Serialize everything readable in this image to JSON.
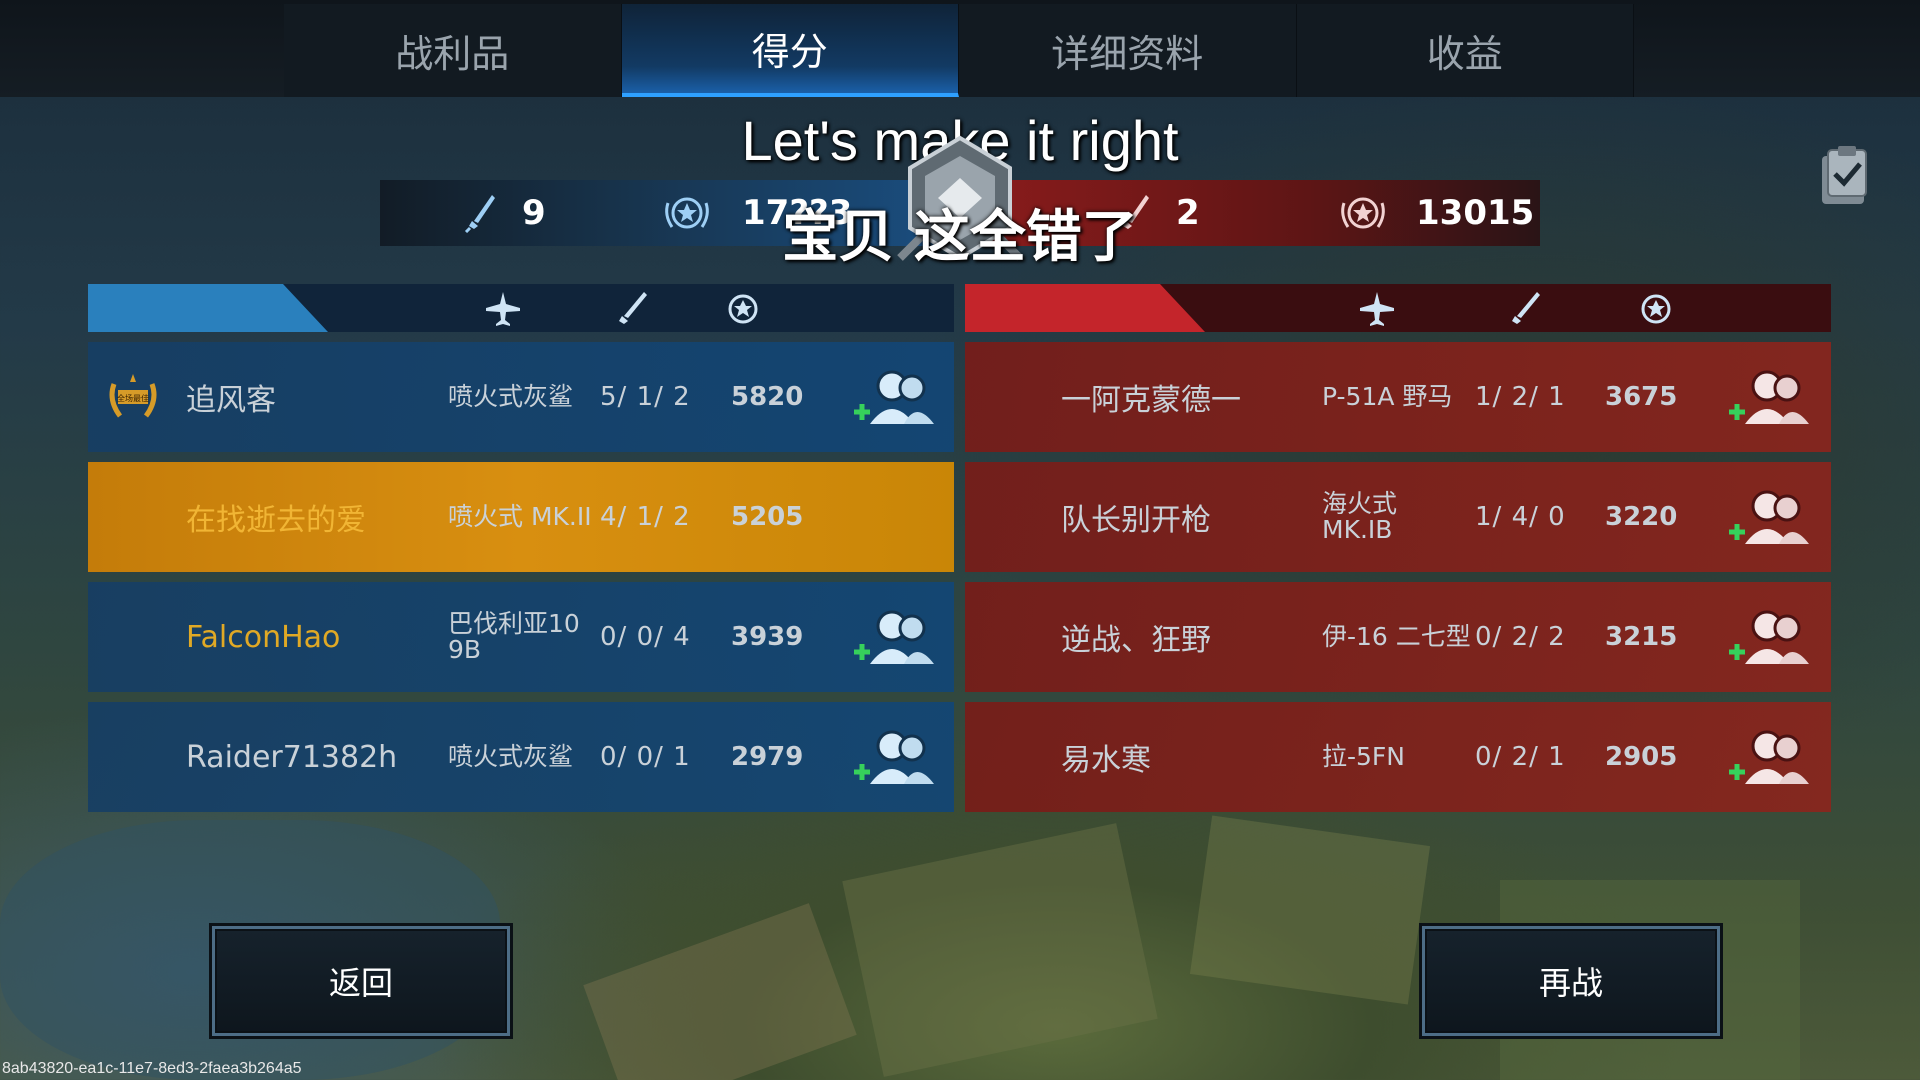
{
  "tabs": [
    {
      "label": "战利品"
    },
    {
      "label": "得分"
    },
    {
      "label": "详细资料"
    },
    {
      "label": "收益"
    }
  ],
  "active_tab": "得分",
  "caption": {
    "top": "Let's make it right",
    "bottom": "宝贝 这全错了"
  },
  "scoreboard": {
    "blue": {
      "kills": "9",
      "score": "17??3"
    },
    "red": {
      "kills": "2",
      "score": "13015"
    }
  },
  "blue_team": [
    {
      "name": "追风客",
      "plane": "喷火式灰鲨",
      "kda": "5/ 1/ 2",
      "score": "5820",
      "mvp": true,
      "mvp_label": "全场最佳",
      "name_style": "normal",
      "self": false
    },
    {
      "name": "在找逝去的爱",
      "plane": "喷火式 MK.II",
      "kda": "4/ 1/ 2",
      "score": "5205",
      "mvp": false,
      "name_style": "gold-self",
      "self": true
    },
    {
      "name": "FalconHao",
      "plane": "巴伐利亚10 9B",
      "kda": "0/ 0/ 4",
      "score": "3939",
      "mvp": false,
      "name_style": "gold",
      "self": false
    },
    {
      "name": "Raider71382h",
      "plane": "喷火式灰鲨",
      "kda": "0/ 0/ 1",
      "score": "2979",
      "mvp": false,
      "name_style": "normal",
      "self": false
    }
  ],
  "red_team": [
    {
      "name": "一阿克蒙德一",
      "plane": "P-51A 野马",
      "kda": "1/ 2/ 1",
      "score": "3675"
    },
    {
      "name": "队长别开枪",
      "plane": "海火式 MK.IB",
      "kda": "1/ 4/ 0",
      "score": "3220"
    },
    {
      "name": "逆战、狂野",
      "plane": "伊-16 二七型",
      "kda": "0/ 2/ 2",
      "score": "3215"
    },
    {
      "name": "易水寒",
      "plane": "拉-5FN",
      "kda": "0/ 2/ 1",
      "score": "2905"
    }
  ],
  "buttons": {
    "back": "返回",
    "again": "再战"
  },
  "footer_id": "8ab43820-ea1c-11e7-8ed3-2faea3b264a5",
  "colors": {
    "blue_team": "#1a4f82",
    "red_team": "#8c1c1c",
    "self_row": "#d88f10",
    "highlight_name": "#e0a925",
    "active_tab_accent": "#2ea0ff"
  },
  "icons": {
    "plane": "plane-icon",
    "kills": "sword-icon",
    "score": "star-wreath-icon",
    "add_friend": "add-friend-icon",
    "clipboard": "clipboard-check-icon",
    "mvp": "laurel-badge-icon",
    "rank": "rank-emblem-icon"
  }
}
